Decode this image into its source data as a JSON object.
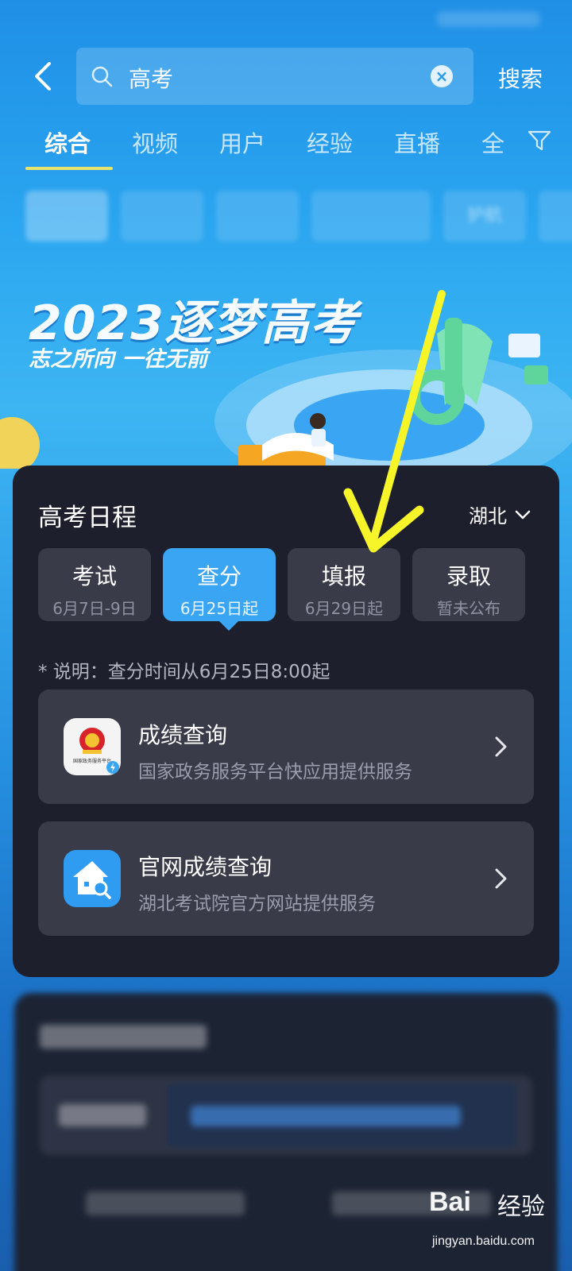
{
  "search": {
    "query": "高考",
    "button_label": "搜索"
  },
  "tabs": [
    {
      "label": "综合",
      "active": true
    },
    {
      "label": "视频"
    },
    {
      "label": "用户"
    },
    {
      "label": "经验"
    },
    {
      "label": "直播"
    },
    {
      "label": "全"
    }
  ],
  "chips": [
    "",
    "",
    "",
    "",
    "护航",
    ""
  ],
  "banner": {
    "title": "2023逐梦高考",
    "subtitle": "志之所向 一往无前"
  },
  "schedule": {
    "title": "高考日程",
    "region": "湖北",
    "stages": [
      {
        "title": "考试",
        "date": "6月7日-9日"
      },
      {
        "title": "查分",
        "date": "6月25日起",
        "active": true
      },
      {
        "title": "填报",
        "date": "6月29日起"
      },
      {
        "title": "录取",
        "date": "暂未公布"
      }
    ],
    "note": "* 说明：查分时间从6月25日8:00起",
    "services": [
      {
        "title": "成绩查询",
        "subtitle": "国家政务服务平台快应用提供服务",
        "icon": "government-emblem-icon",
        "icon_caption": "国家政务服务平台"
      },
      {
        "title": "官网成绩查询",
        "subtitle": "湖北考试院官方网站提供服务",
        "icon": "house-search-icon"
      }
    ]
  },
  "watermark": {
    "logo": "Bai",
    "logo2": "经验",
    "url": "jingyan.baidu.com"
  },
  "colors": {
    "accent": "#3aa6f3",
    "card_bg": "#1d1f2c",
    "underline": "#e7e36e",
    "arrow": "#f5f52a"
  }
}
